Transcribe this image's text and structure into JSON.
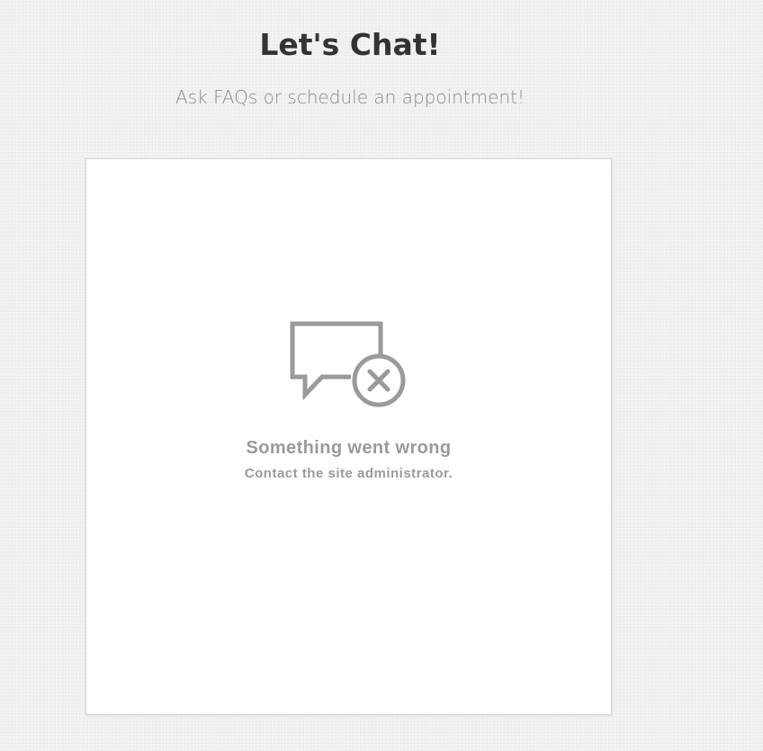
{
  "header": {
    "title": "Let's Chat!",
    "subtitle": "Ask FAQs or schedule an appointment!"
  },
  "chat_widget": {
    "error_icon": "chat-bubble-error-icon",
    "error_title": "Something went wrong",
    "error_message": "Contact the site administrator."
  },
  "colors": {
    "background": "#f1f1f1",
    "title": "#333333",
    "subtitle": "#8c8c8c",
    "panel": "#ffffff",
    "icon_and_error_text": "#9a9a9a"
  }
}
